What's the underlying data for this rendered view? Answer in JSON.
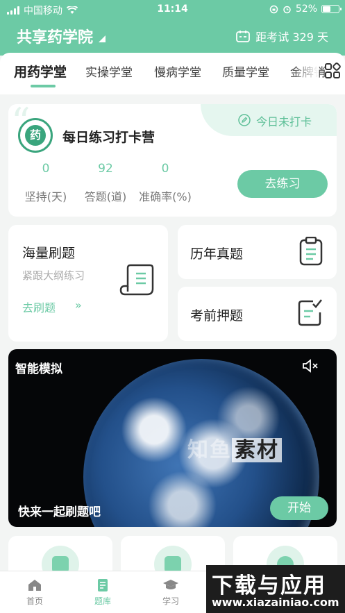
{
  "status_bar": {
    "carrier": "中国移动",
    "time": "11:14",
    "battery": "52%"
  },
  "header": {
    "title": "共享药学院",
    "exam_countdown": "距考试 329 天"
  },
  "tabs": [
    "用药学堂",
    "实操学堂",
    "慢病学堂",
    "质量学堂",
    "金牌销"
  ],
  "checkin": {
    "title": "每日练习打卡营",
    "status": "今日未打卡",
    "logo_char": "药",
    "stats": [
      {
        "value": "0",
        "label": "坚持(天)"
      },
      {
        "value": "92",
        "label": "答题(道)"
      },
      {
        "value": "0",
        "label": "准确率(%)"
      }
    ],
    "button": "去练习"
  },
  "question_bank": {
    "title": "海量刷题",
    "subtitle": "紧跟大纲练习",
    "link": "去刷题"
  },
  "past_papers": {
    "title": "历年真题"
  },
  "pre_exam": {
    "title": "考前押题"
  },
  "video": {
    "title": "智能模拟",
    "subtitle": "快来一起刷题吧",
    "button": "开始",
    "watermark_a": "知鱼",
    "watermark_b": "素材"
  },
  "bottom_nav": [
    {
      "label": "首页",
      "icon": "home-icon"
    },
    {
      "label": "题库",
      "icon": "question-bank-icon"
    },
    {
      "label": "学习",
      "icon": "graduation-cap-icon"
    }
  ],
  "footer_watermark": {
    "text": "下载与应用",
    "url": "www.xiazainiao.com"
  },
  "colors": {
    "accent": "#6ccaa5",
    "background": "#f3f5f4"
  }
}
